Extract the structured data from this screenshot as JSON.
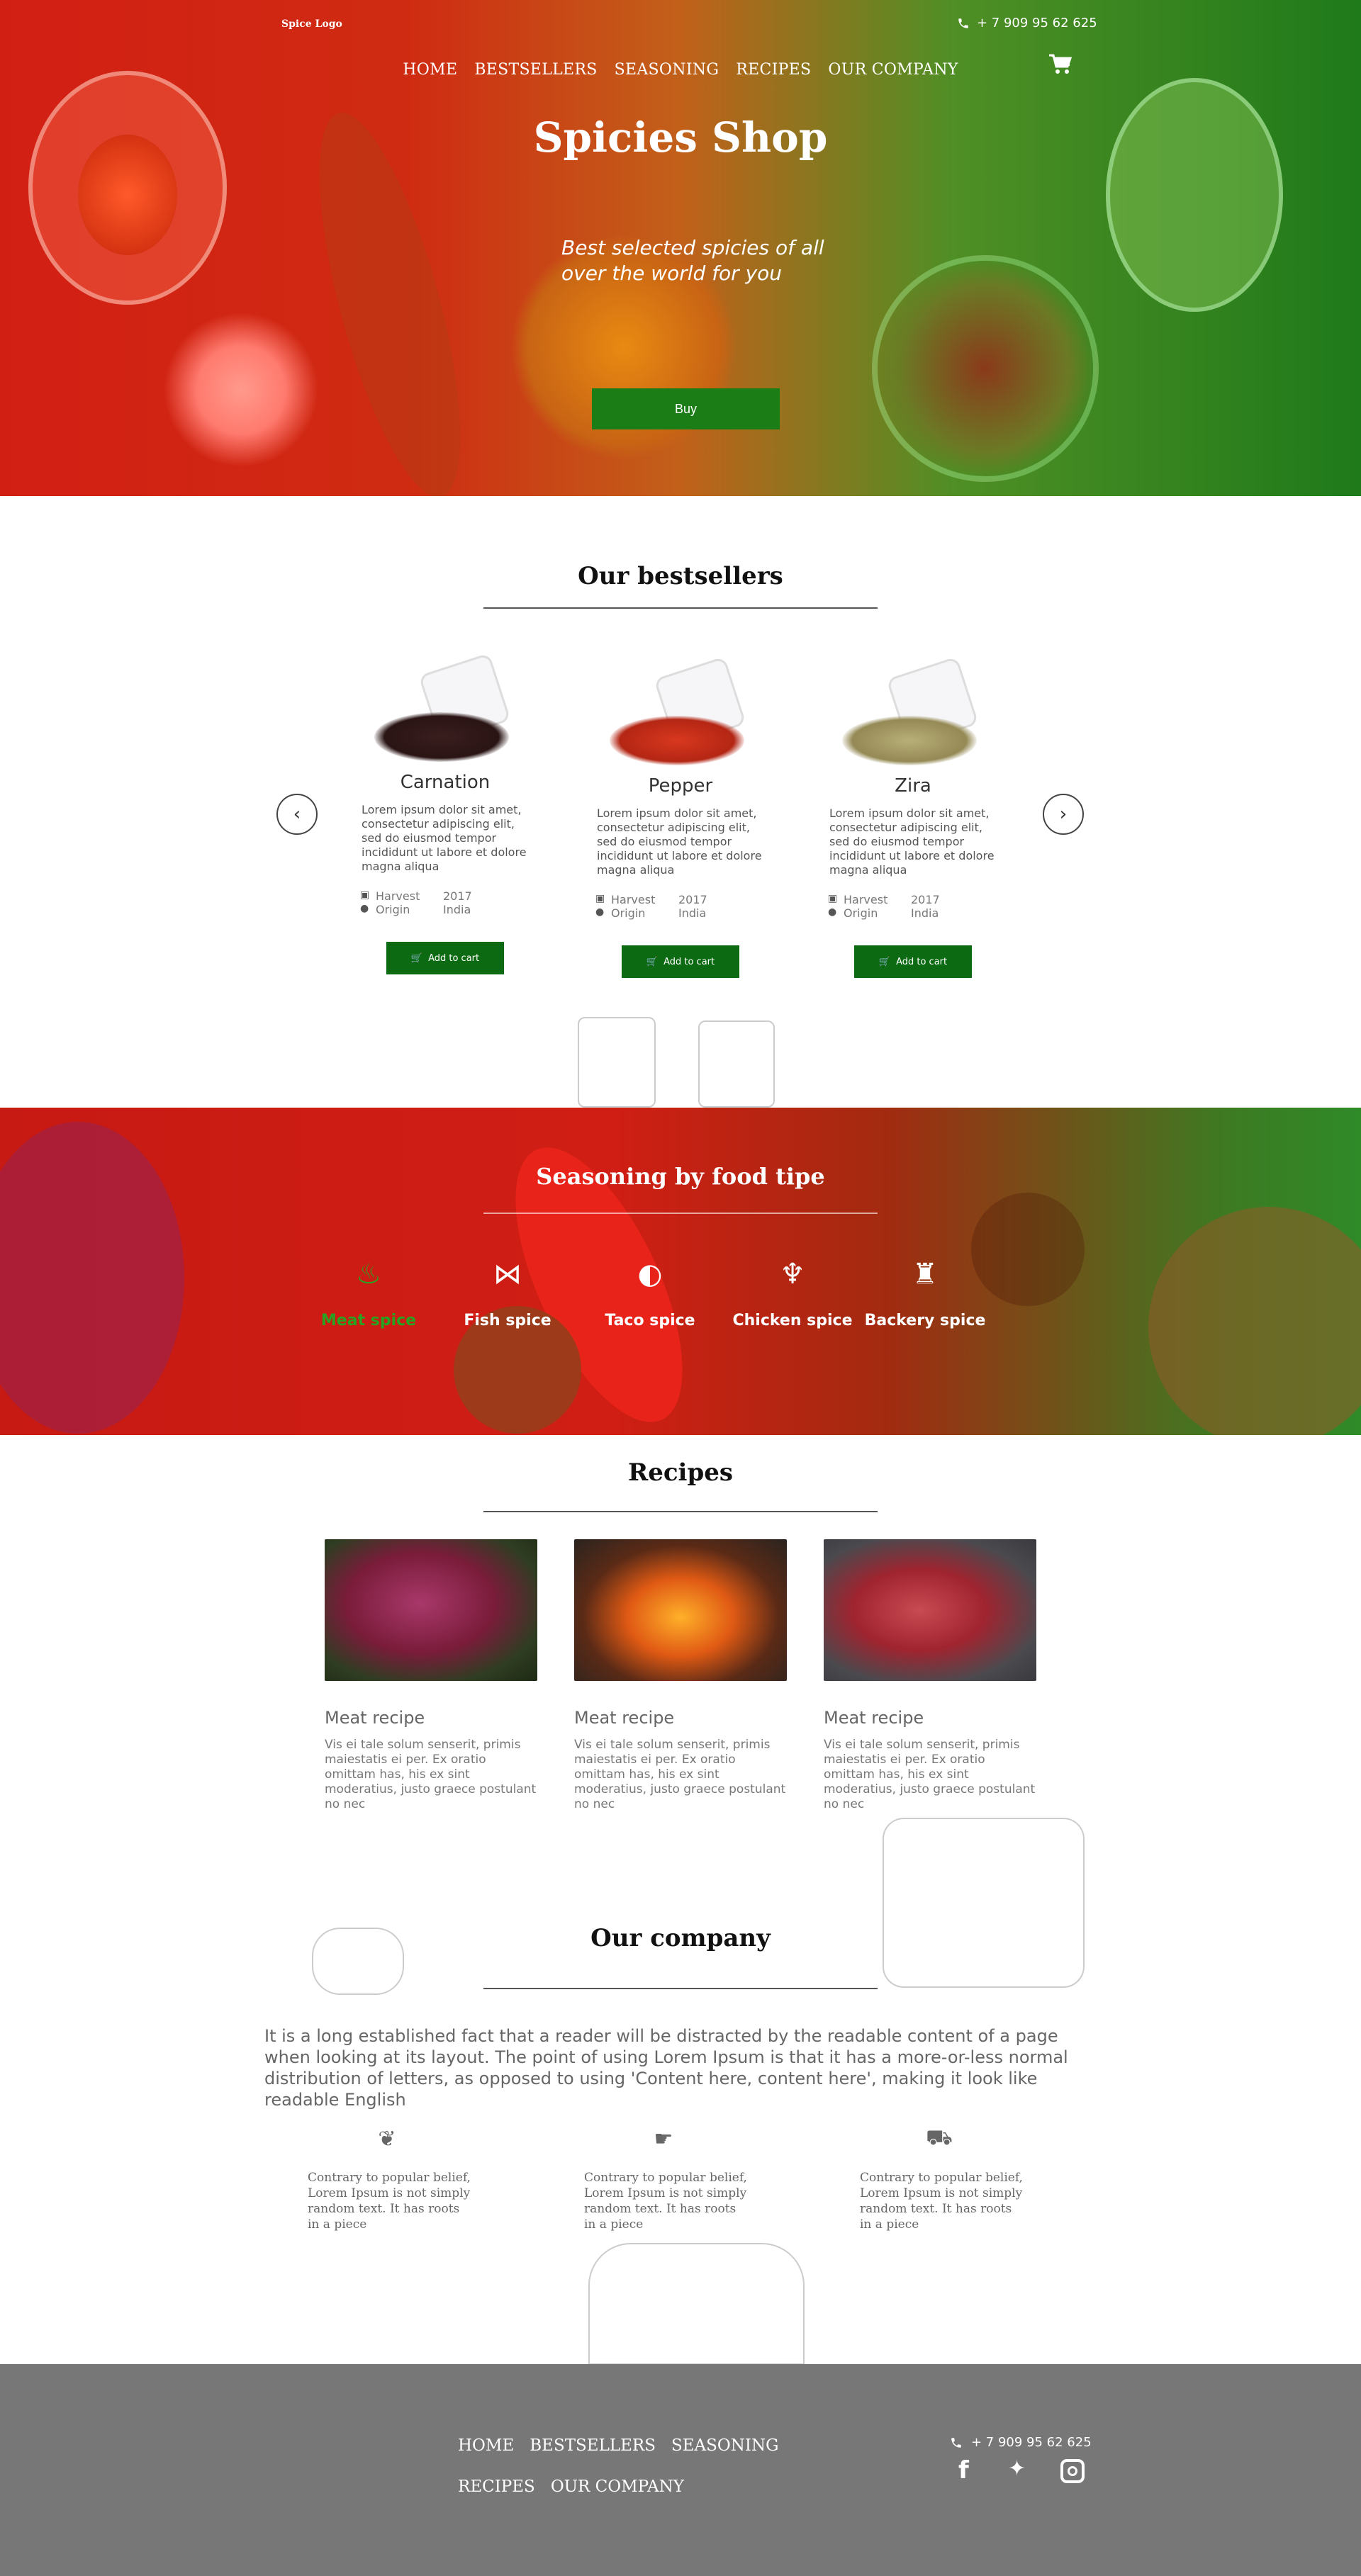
{
  "header": {
    "logo": "Spice Logo",
    "phone": "+ 7 909 95 62 625",
    "nav": [
      "HOME",
      "BESTSELLERS",
      "SEASONING",
      "RECIPES",
      "OUR COMPANY"
    ],
    "cart_icon": "cart-icon"
  },
  "hero": {
    "title": "Spicies Shop",
    "subtitle": "Best selected spicies of all over the world for you",
    "buy_label": "Buy"
  },
  "bestsellers": {
    "title": "Our bestsellers",
    "products": [
      {
        "name": "Carnation",
        "description": "Lorem ipsum dolor sit amet, consectetur adipiscing elit, sed do eiusmod tempor incididunt ut labore et dolore magna aliqua",
        "harvest_label": "Harvest",
        "harvest": "2017",
        "origin_label": "Origin",
        "origin": "India",
        "button": "Add to cart",
        "color": "#3a1e1e"
      },
      {
        "name": "Pepper",
        "description": "Lorem ipsum dolor sit amet, consectetur adipiscing elit, sed do eiusmod tempor incididunt ut labore et dolore magna aliqua",
        "harvest_label": "Harvest",
        "harvest": "2017",
        "origin_label": "Origin",
        "origin": "India",
        "button": "Add to cart",
        "color": "#c9301a"
      },
      {
        "name": "Zira",
        "description": "Lorem ipsum dolor sit amet, consectetur adipiscing elit, sed do eiusmod tempor incididunt ut labore et dolore magna aliqua",
        "harvest_label": "Harvest",
        "harvest": "2017",
        "origin_label": "Origin",
        "origin": "India",
        "button": "Add to cart",
        "color": "#a8a06a"
      }
    ]
  },
  "seasoning": {
    "title": "Seasoning by food tipe",
    "types": [
      {
        "label": "Meat spice",
        "icon": "meat-icon",
        "active": true
      },
      {
        "label": "Fish spice",
        "icon": "fish-icon",
        "active": false
      },
      {
        "label": "Taco spice",
        "icon": "taco-icon",
        "active": false
      },
      {
        "label": "Chicken spice",
        "icon": "chicken-icon",
        "active": false
      },
      {
        "label": "Backery spice",
        "icon": "bakery-icon",
        "active": false
      }
    ]
  },
  "recipes": {
    "title": "Recipes",
    "items": [
      {
        "name": "Meat recipe",
        "description": "Vis ei tale solum senserit, primis maiestatis ei per. Ex oratio omittam has, his ex sint moderatius, justo graece postulant no nec"
      },
      {
        "name": "Meat recipe",
        "description": "Vis ei tale solum senserit, primis maiestatis ei per. Ex oratio omittam has, his ex sint moderatius, justo graece postulant no nec"
      },
      {
        "name": "Meat recipe",
        "description": "Vis ei tale solum senserit, primis maiestatis ei per. Ex oratio omittam has, his ex sint moderatius, justo graece postulant no nec"
      }
    ]
  },
  "company": {
    "title": "Our company",
    "text": "It is a long established fact that a reader will be distracted by the readable content of a page when looking at its layout. The point of using Lorem Ipsum is that it has a more-or-less normal distribution of letters, as opposed to using 'Content here, content here', making it look like readable English",
    "features": [
      {
        "icon": "leaf-icon",
        "text": "Contrary to popular belief,\nLorem Ipsum is not simply\n random text. It has roots\nin a piece"
      },
      {
        "icon": "hand-icon",
        "text": "Contrary to popular belief,\nLorem Ipsum is not simply\n random text. It has roots\nin a piece"
      },
      {
        "icon": "car-icon",
        "text": "Contrary to popular belief,\nLorem Ipsum is not simply\n random text. It has roots\nin a piece"
      }
    ]
  },
  "footer": {
    "nav_row1": [
      "HOME",
      "BESTSELLERS",
      "SEASONING"
    ],
    "nav_row2": [
      "RECIPES",
      "OUR COMPANY"
    ],
    "phone": "+ 7 909 95 62 625",
    "social": [
      "facebook-icon",
      "twitter-icon",
      "instagram-icon"
    ]
  },
  "colors": {
    "brand_green": "#0c6b12",
    "active_green": "#27a321",
    "hero_red": "#d21f14",
    "footer_gray": "#777777"
  }
}
